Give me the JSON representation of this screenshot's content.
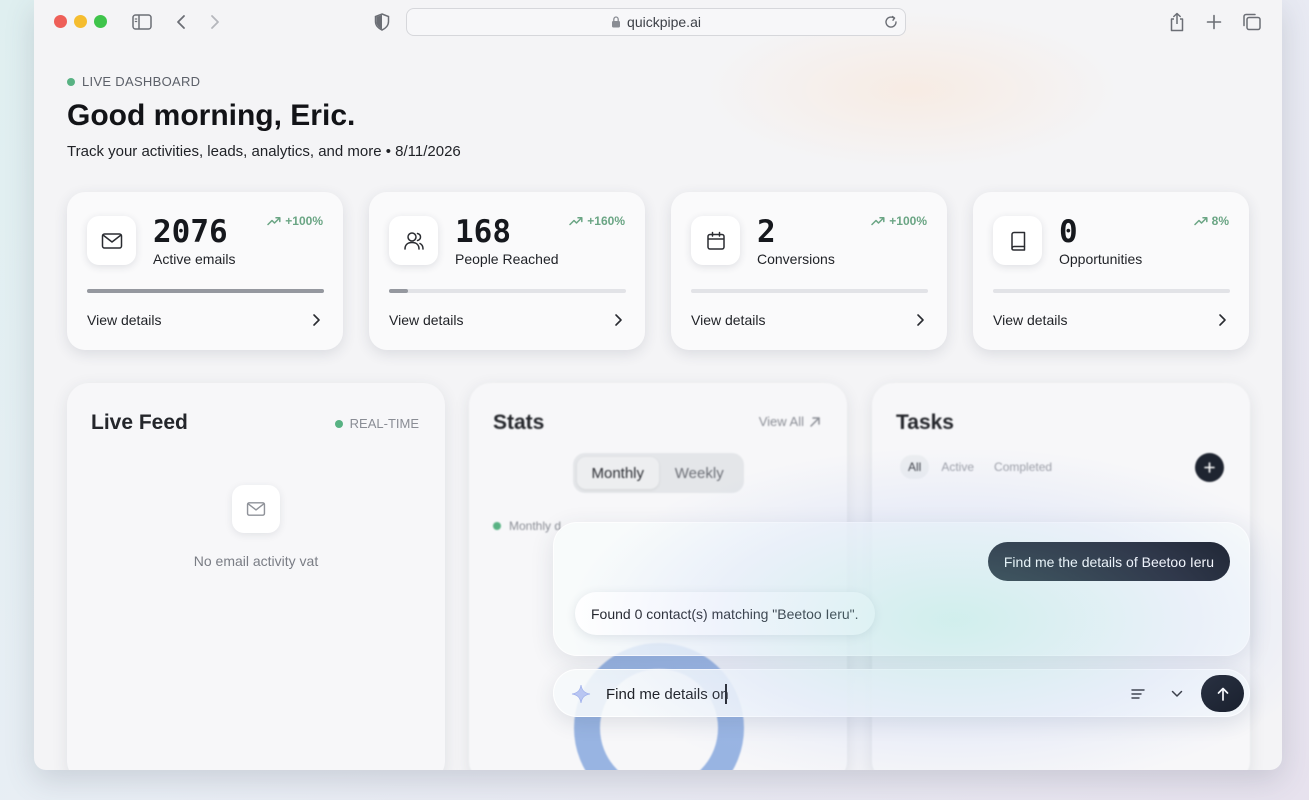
{
  "browser": {
    "url": "quickpipe.ai"
  },
  "header": {
    "badge": "LIVE DASHBOARD",
    "greeting": "Good morning, Eric.",
    "subtitle": "Track your activities, leads, analytics, and more • 8/11/2026"
  },
  "stats": [
    {
      "icon": "mail-icon",
      "value": "2076",
      "label": "Active emails",
      "trend": "+100%",
      "progress": 1.0,
      "link": "View details"
    },
    {
      "icon": "users-icon",
      "value": "168",
      "label": "People Reached",
      "trend": "+160%",
      "progress": 0.08,
      "link": "View details"
    },
    {
      "icon": "calendar-icon",
      "value": "2",
      "label": "Conversions",
      "trend": "+100%",
      "progress": 0.0,
      "link": "View details"
    },
    {
      "icon": "book-icon",
      "value": "0",
      "label": "Opportunities",
      "trend": "8%",
      "progress": 0.0,
      "link": "View details"
    }
  ],
  "live_feed": {
    "title": "Live Feed",
    "status": "REAL-TIME",
    "empty_text": "No email activity vat"
  },
  "stats_panel": {
    "title": "Stats",
    "view_all": "View All",
    "toggle": [
      "Monthly",
      "Weekly"
    ],
    "active_toggle": "Monthly",
    "legend": "Monthly d"
  },
  "tasks": {
    "title": "Tasks",
    "tabs": [
      "All",
      "Active",
      "Completed"
    ],
    "active_tab": "All"
  },
  "chat": {
    "user_message": "Find me the details of Beetoo Ieru",
    "bot_message": "Found 0 contact(s) matching \"Beetoo Ieru\".",
    "input_value": "Find me details on "
  },
  "colors": {
    "accent_dark": "#151b27",
    "live_green": "#58b283",
    "trend_green": "#6aa584"
  }
}
